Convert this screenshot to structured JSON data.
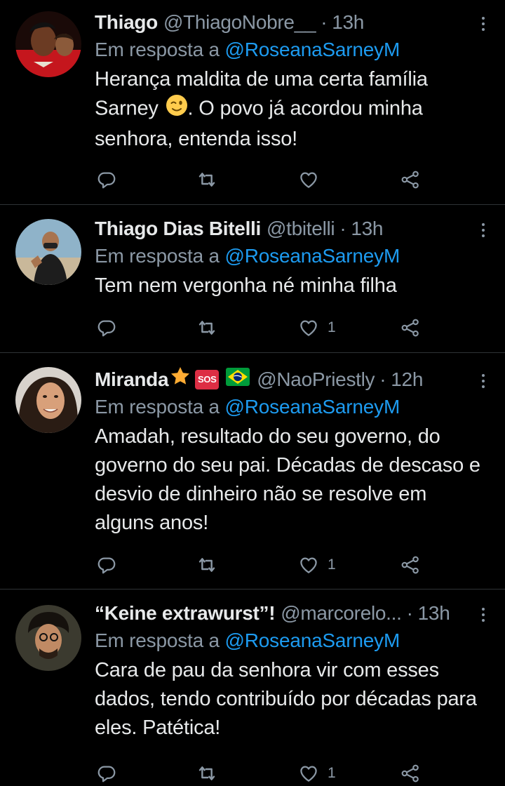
{
  "tweets": [
    {
      "display_name": "Thiago",
      "handle": "@ThiagoNobre__",
      "time": "13h",
      "reply_prefix": "Em resposta a",
      "reply_to": "@RoseanaSarneyM",
      "text_part1": "Herança maldita de uma certa família Sarney ",
      "text_part2": ". O povo já acordou minha senhora, entenda isso!",
      "like_count": ""
    },
    {
      "display_name": "Thiago Dias Bitelli",
      "handle": "@tbitelli",
      "time": "13h",
      "reply_prefix": "Em resposta a",
      "reply_to": "@RoseanaSarneyM",
      "text": "Tem nem vergonha né minha filha",
      "like_count": "1"
    },
    {
      "display_name": "Miranda",
      "badge_sos": "SOS",
      "handle": "@NaoPriestly",
      "time": "12h",
      "reply_prefix": "Em resposta a",
      "reply_to": "@RoseanaSarneyM",
      "text": "Amadah, resultado do seu governo, do governo do seu pai. Décadas de descaso e desvio de dinheiro não se resolve em alguns anos!",
      "like_count": "1"
    },
    {
      "display_name": "“Keine extrawurst”!",
      "handle": "@marcorelo...",
      "time": "13h",
      "reply_prefix": "Em resposta a",
      "reply_to": "@RoseanaSarneyM",
      "text": "Cara de pau da senhora vir com esses dados, tendo contribuído por décadas para eles. Patética!",
      "like_count": "1"
    }
  ],
  "theme": {
    "background": "#000000",
    "primary_text": "#e7e9ea",
    "secondary_text": "#8b98a5",
    "mention": "#1d9bf0",
    "divider": "#2f3336"
  },
  "icons": [
    "reply-icon",
    "retweet-icon",
    "like-icon",
    "share-icon",
    "more-options-icon",
    "wink-emoji-icon",
    "star-emoji-icon",
    "sos-emoji-icon",
    "brazil-flag-icon"
  ]
}
